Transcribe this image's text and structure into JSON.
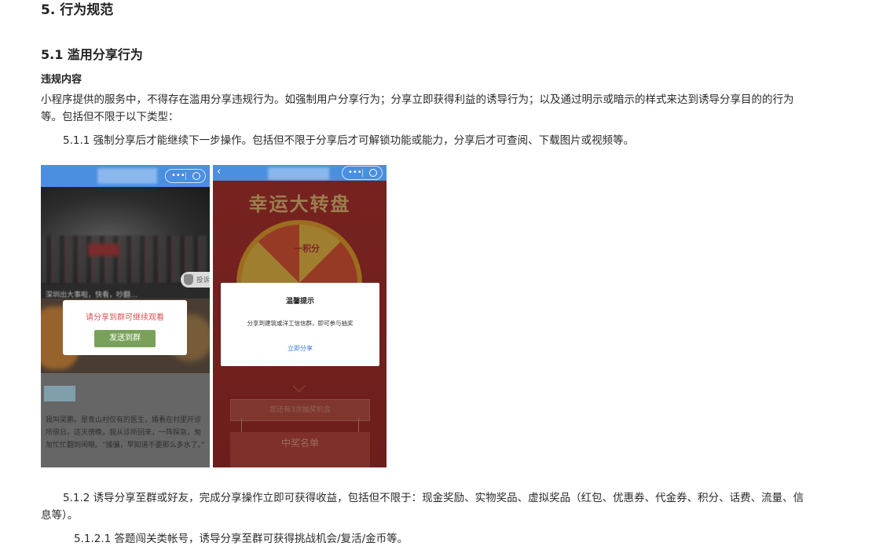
{
  "doc": {
    "h5": "5. 行为规范",
    "h51": "5.1 滥用分享行为",
    "sub": "违规内容",
    "para": "小程序提供的服务中，不得存在滥用分享违规行为。如强制用户分享行为；分享立即获得利益的诱导行为；以及通过明示或暗示的样式来达到诱导分享目的的行为等。包括但不限于以下类型：",
    "item1": "5.1.1 强制分享后才能继续下一步操作。包括但不限于分享后才可解锁功能或能力，分享后才可查阅、下载图片或视频等。",
    "item2": "5.1.2 诱导分享至群或好友，完成分享操作立即可获得收益，包括但不限于：现金奖励、实物奖品、虚拟奖品（红包、优惠券、代金券、积分、话费、流量、信息等）。",
    "item3": "5.1.2.1 答题闯关类帐号，诱导分享至群可获得挑战机会/复活/金币等。"
  },
  "phone1": {
    "caption": "深圳出大事啦，快看，吵翻…",
    "report": "投诉",
    "dialog_msg": "请分享到群可继续观看",
    "dialog_btn": "发送到群",
    "lower_text": "我叫吴鹏，是青山村仅有的医生，婚看在村里开诊所很日。这天傍晚，我从诊所回来，一阵探急，匆匆忙忙翻到闲眼。“揉骗，早知道不要那么多水了。”"
  },
  "phone2": {
    "heading": "幸运大转盘",
    "wheel_label": "一积分",
    "dialog_title": "温馨提示",
    "dialog_msg": "分享到建筑或洋工信信群，即可参与抽奖",
    "dialog_link": "立即分享",
    "chance": "您还有3次抽奖机会",
    "winners": "中奖名单"
  },
  "colors": {
    "topbar": "#4a8fe0",
    "p1_button": "#7aa15a",
    "p1_msg": "#d9534f",
    "p2_bg": "#b73a36",
    "p2_link": "#3a7bd5"
  }
}
